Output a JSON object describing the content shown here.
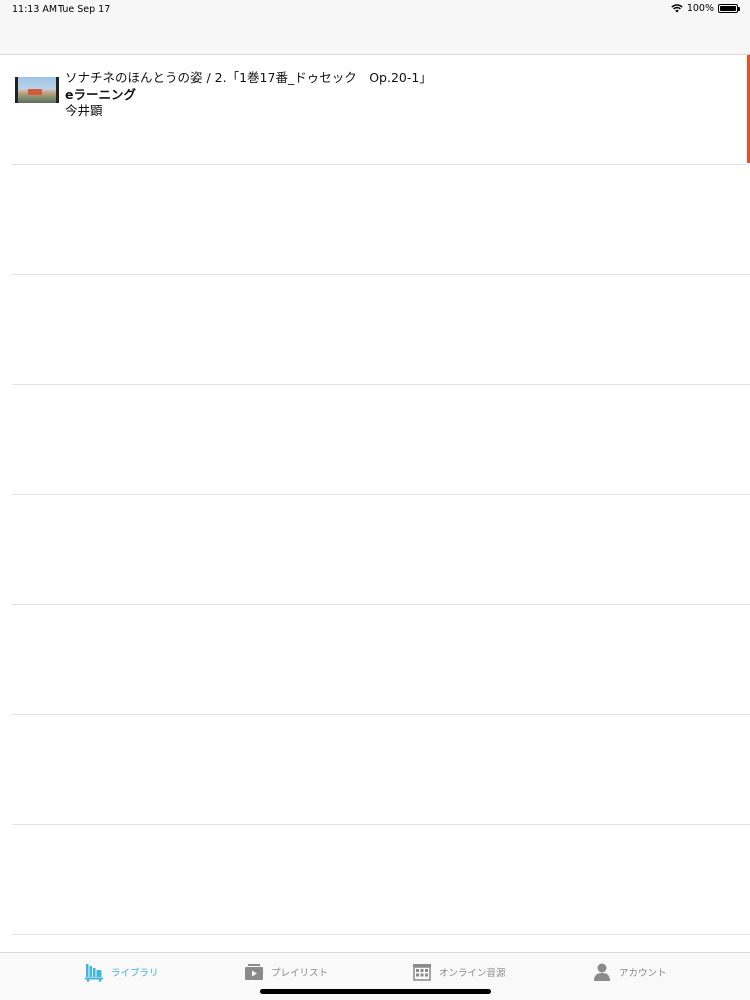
{
  "status_bar": {
    "time": "11:13 AM",
    "date": "Tue Sep 17",
    "battery": "100%"
  },
  "list": {
    "items": [
      {
        "title": "ソナチネのほんとうの姿 / 2.「1巻17番_ドゥセック　Op.20-1」",
        "subtitle": "eラーニング",
        "author": "今井顕"
      }
    ]
  },
  "tabs": [
    {
      "label": "ライブラリ",
      "icon": "library-icon",
      "active": true
    },
    {
      "label": "プレイリスト",
      "icon": "playlist-icon",
      "active": false
    },
    {
      "label": "オンライン音源",
      "icon": "store-icon",
      "active": false
    },
    {
      "label": "アカウント",
      "icon": "account-icon",
      "active": false
    }
  ],
  "colors": {
    "accent": "#3fb4e0",
    "row_marker": "#e8502a"
  }
}
